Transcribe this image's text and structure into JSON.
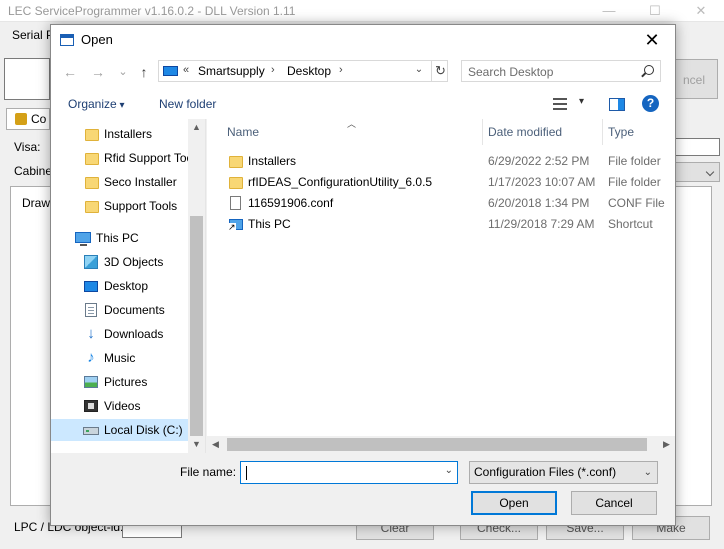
{
  "app": {
    "title": "LEC ServiceProgrammer v1.16.0.2 - DLL Version 1.11",
    "controls": {
      "minimize": "—",
      "maximize": "☐",
      "close": "✕"
    },
    "serial_label": "Serial P",
    "cancel_label": "ncel",
    "tab_label": "Co",
    "visa_label": "Visa:",
    "cabinet_label": "Cabinet",
    "drawer_label": "Drawe",
    "lpc_label": "LPC / LDC object-id:",
    "buttons": {
      "clear": "Clear",
      "check": "Check...",
      "save": "Save...",
      "make": "Make"
    }
  },
  "dialog": {
    "title": "Open",
    "close": "✕",
    "nav": {
      "back": "←",
      "forward": "→",
      "recent": "⌄",
      "up": "↑"
    },
    "address": {
      "overflow": "«",
      "parts": [
        "Smartsupply",
        "Desktop"
      ],
      "separator": "›",
      "dropdown": "⌄",
      "refresh": "↻"
    },
    "search": {
      "placeholder": "Search Desktop",
      "value": ""
    },
    "toolbar": {
      "organize": "Organize",
      "new_folder": "New folder",
      "view_drop": "▾",
      "help": "?"
    },
    "tree": [
      {
        "label": "Installers",
        "icon": "folder-icon",
        "selected": false
      },
      {
        "label": "Rfid Support Too",
        "icon": "folder-icon",
        "selected": false
      },
      {
        "label": "Seco Installer",
        "icon": "folder-icon",
        "selected": false
      },
      {
        "label": "Support Tools",
        "icon": "folder-icon",
        "selected": false
      },
      {
        "label": "This PC",
        "icon": "pc-icon",
        "selected": false
      },
      {
        "label": "3D Objects",
        "icon": "cube-icon",
        "selected": false
      },
      {
        "label": "Desktop",
        "icon": "desktop-icon",
        "selected": false
      },
      {
        "label": "Documents",
        "icon": "doc-icon",
        "selected": false
      },
      {
        "label": "Downloads",
        "icon": "download-icon",
        "selected": false
      },
      {
        "label": "Music",
        "icon": "music-icon",
        "selected": false
      },
      {
        "label": "Pictures",
        "icon": "pictures-icon",
        "selected": false
      },
      {
        "label": "Videos",
        "icon": "videos-icon",
        "selected": false
      },
      {
        "label": "Local Disk (C:)",
        "icon": "disk-icon",
        "selected": true
      }
    ],
    "columns": {
      "name": "Name",
      "date": "Date modified",
      "type": "Type"
    },
    "files": [
      {
        "name": "Installers",
        "date": "6/29/2022 2:52 PM",
        "type": "File folder",
        "icon": "folder-icon"
      },
      {
        "name": "rfIDEAS_ConfigurationUtility_6.0.5",
        "date": "1/17/2023 10:07 AM",
        "type": "File folder",
        "icon": "folder-icon"
      },
      {
        "name": "116591906.conf",
        "date": "6/20/2018 1:34 PM",
        "type": "CONF File",
        "icon": "conf-icon"
      },
      {
        "name": "This PC",
        "date": "11/29/2018 7:29 AM",
        "type": "Shortcut",
        "icon": "shortcut-icon"
      }
    ],
    "filename": {
      "label": "File name:",
      "value": "",
      "dropdown": "⌄"
    },
    "filter": {
      "value": "Configuration Files (*.conf)",
      "dropdown": "⌄"
    },
    "buttons": {
      "open": "Open",
      "cancel": "Cancel"
    },
    "accent_color": "#0078d7",
    "selection_color": "#cce8ff"
  }
}
